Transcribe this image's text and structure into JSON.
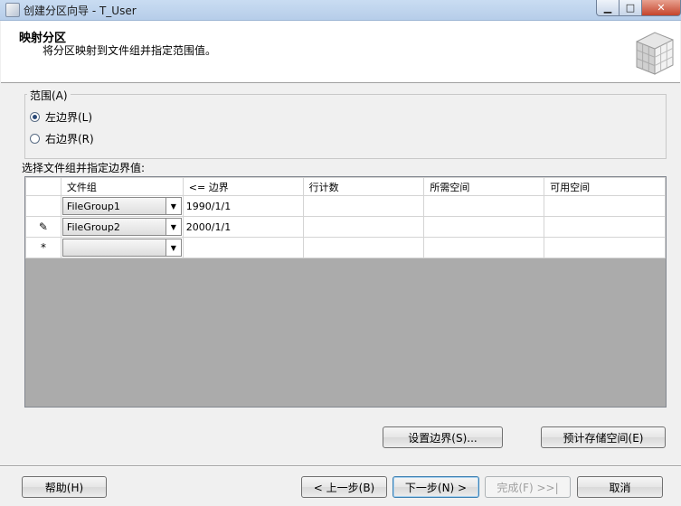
{
  "window": {
    "title": "创建分区向导 - T_User",
    "controls": {
      "minimize": "▁",
      "maximize": "□",
      "close": "✕"
    }
  },
  "header": {
    "title": "映射分区",
    "subtitle": "将分区映射到文件组并指定范围值。",
    "icon": "cube-icon"
  },
  "range": {
    "label": "范围(A)",
    "options": [
      {
        "label": "左边界(L)",
        "checked": true
      },
      {
        "label": "右边界(R)",
        "checked": false
      }
    ]
  },
  "grid": {
    "section_label": "选择文件组并指定边界值:",
    "columns": [
      "文件组",
      "<= 边界",
      "行计数",
      "所需空间",
      "可用空间"
    ],
    "rows": [
      {
        "row_header": "",
        "filegroup": "FileGroup1",
        "boundary": "1990/1/1",
        "row_count": "",
        "required_space": "",
        "available_space": ""
      },
      {
        "row_header": "✎",
        "filegroup": "FileGroup2",
        "boundary": "2000/1/1",
        "row_count": "",
        "required_space": "",
        "available_space": ""
      },
      {
        "row_header": "*",
        "filegroup": "",
        "boundary": "",
        "row_count": "",
        "required_space": "",
        "available_space": ""
      }
    ]
  },
  "actions": {
    "set_boundaries": "设置边界(S)...",
    "estimate_storage": "预计存储空间(E)"
  },
  "footer": {
    "help": "帮助(H)",
    "back": "< 上一步(B)",
    "next": "下一步(N) >",
    "finish": "完成(F) >>|",
    "cancel": "取消"
  }
}
